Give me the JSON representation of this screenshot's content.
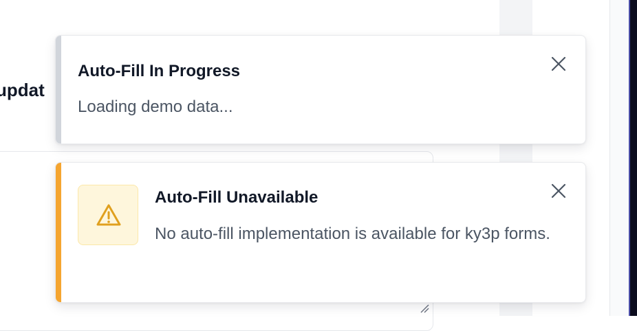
{
  "background": {
    "heading_fragment": "updat"
  },
  "toasts": [
    {
      "title": "Auto-Fill In Progress",
      "description": "Loading demo data...",
      "accent_color": "#d1d5db",
      "close_icon": "close-icon"
    },
    {
      "title": "Auto-Fill Unavailable",
      "description": "No auto-fill implementation is available for ky3p forms.",
      "accent_color": "#f5a530",
      "status_icon": "warning-triangle-icon",
      "close_icon": "close-icon"
    }
  ]
}
